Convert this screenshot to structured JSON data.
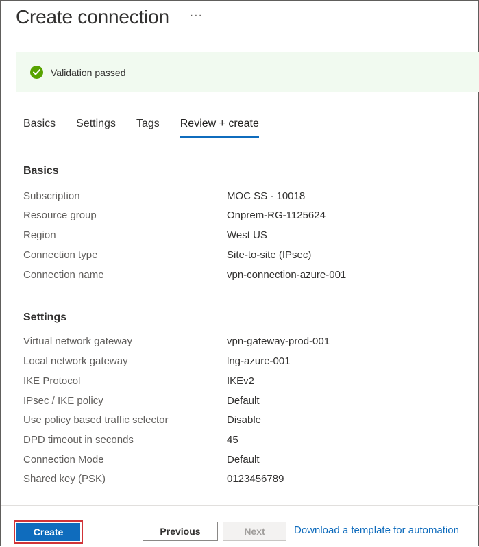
{
  "header": {
    "title": "Create connection",
    "more_label": "···"
  },
  "banner": {
    "icon": "checkmark-circle-icon",
    "text": "Validation passed",
    "status_color": "#57a300",
    "background": "#f1faf0"
  },
  "tabs": [
    {
      "label": "Basics",
      "active": false
    },
    {
      "label": "Settings",
      "active": false
    },
    {
      "label": "Tags",
      "active": false
    },
    {
      "label": "Review + create",
      "active": true
    }
  ],
  "basics": {
    "title": "Basics",
    "rows": [
      {
        "label": "Subscription",
        "value": "MOC SS - 10018"
      },
      {
        "label": "Resource group",
        "value": "Onprem-RG-1125624"
      },
      {
        "label": "Region",
        "value": "West US"
      },
      {
        "label": "Connection type",
        "value": "Site-to-site (IPsec)"
      },
      {
        "label": "Connection name",
        "value": "vpn-connection-azure-001"
      }
    ]
  },
  "settings": {
    "title": "Settings",
    "rows": [
      {
        "label": "Virtual network gateway",
        "value": "vpn-gateway-prod-001"
      },
      {
        "label": "Local network gateway",
        "value": "lng-azure-001"
      },
      {
        "label": "IKE Protocol",
        "value": "IKEv2"
      },
      {
        "label": "IPsec / IKE policy",
        "value": "Default"
      },
      {
        "label": "Use policy based traffic selector",
        "value": "Disable"
      },
      {
        "label": "DPD timeout in seconds",
        "value": "45"
      },
      {
        "label": "Connection Mode",
        "value": "Default"
      },
      {
        "label": "Shared key (PSK)",
        "value": "0123456789"
      }
    ]
  },
  "footer": {
    "create_label": "Create",
    "previous_label": "Previous",
    "next_label": "Next",
    "download_link": "Download a template for automation",
    "accent_color": "#0f6cbd",
    "highlight_color": "#d13438"
  }
}
